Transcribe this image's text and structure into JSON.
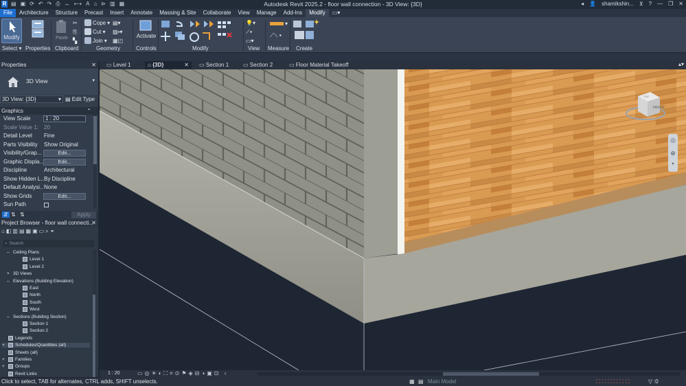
{
  "app": {
    "title": "Autodesk Revit 2025.2 - floor wall connection - 3D View: {3D}",
    "logo_letter": "R",
    "user": "shamikshin...",
    "help": "?"
  },
  "ribbon_tabs": [
    "File",
    "Architecture",
    "Structure",
    "Precast",
    "Insert",
    "Annotate",
    "Massing & Site",
    "Collaborate",
    "View",
    "Manage",
    "Add-Ins",
    "Modify"
  ],
  "ribbon": {
    "modify_label": "Modify",
    "select_label": "Select",
    "properties_label": "Properties",
    "clipboard_label": "Clipboard",
    "paste_label": "Paste",
    "cope_label": "Cope",
    "cut_label": "Cut",
    "join_label": "Join",
    "geometry_label": "Geometry",
    "activate_label": "Activate",
    "controls_label": "Controls",
    "modify_panel_label": "Modify",
    "view_label": "View",
    "measure_label": "Measure",
    "create_label": "Create"
  },
  "properties": {
    "title": "Properties",
    "type_name": "3D View",
    "selector": "3D View: {3D}",
    "edit_type": "Edit Type",
    "group": "Graphics",
    "rows": [
      {
        "k": "View Scale",
        "v": "1 : 20"
      },
      {
        "k": "Scale Value  1:",
        "v": "20"
      },
      {
        "k": "Detail Level",
        "v": "Fine"
      },
      {
        "k": "Parts Visibility",
        "v": "Show Original"
      },
      {
        "k": "Visibility/Grap...",
        "v": "Edit..."
      },
      {
        "k": "Graphic Displa...",
        "v": "Edit..."
      },
      {
        "k": "Discipline",
        "v": "Architectural"
      },
      {
        "k": "Show Hidden L...",
        "v": "By Discipline"
      },
      {
        "k": "Default Analysi...",
        "v": "None"
      },
      {
        "k": "Show Grids",
        "v": "Edit..."
      },
      {
        "k": "Sun Path",
        "v": ""
      }
    ],
    "apply": "Apply"
  },
  "browser": {
    "title": "Project Browser - floor wall connecti...",
    "search_placeholder": "Search",
    "items": [
      {
        "label": "Ceiling Plans",
        "indent": 1,
        "expander": "–"
      },
      {
        "label": "Level 1",
        "indent": 3,
        "expander": ""
      },
      {
        "label": "Level 2",
        "indent": 3,
        "expander": ""
      },
      {
        "label": "3D Views",
        "indent": 1,
        "expander": "+"
      },
      {
        "label": "Elevations (Building Elevation)",
        "indent": 1,
        "expander": "–"
      },
      {
        "label": "East",
        "indent": 3,
        "expander": ""
      },
      {
        "label": "North",
        "indent": 3,
        "expander": ""
      },
      {
        "label": "South",
        "indent": 3,
        "expander": ""
      },
      {
        "label": "West",
        "indent": 3,
        "expander": ""
      },
      {
        "label": "Sections (Building Section)",
        "indent": 1,
        "expander": "–"
      },
      {
        "label": "Section 1",
        "indent": 3,
        "expander": ""
      },
      {
        "label": "Section 2",
        "indent": 3,
        "expander": ""
      },
      {
        "label": "Legends",
        "indent": 0,
        "expander": ""
      },
      {
        "label": "Schedules/Quantities (all)",
        "indent": 0,
        "expander": "+"
      },
      {
        "label": "Sheets (all)",
        "indent": 0,
        "expander": ""
      },
      {
        "label": "Families",
        "indent": 0,
        "expander": "+"
      },
      {
        "label": "Groups",
        "indent": 0,
        "expander": "+"
      },
      {
        "label": "Revit Links",
        "indent": 0,
        "expander": ""
      }
    ]
  },
  "view_tabs": [
    {
      "label": "Level 1",
      "active": false
    },
    {
      "label": "{3D}",
      "active": true
    },
    {
      "label": "Section 1",
      "active": false
    },
    {
      "label": "Section 2",
      "active": false
    },
    {
      "label": "Floor Material Takeoff",
      "active": false
    }
  ],
  "viewcube": {
    "face_label": "FRONT",
    "top_label": "TOP"
  },
  "view_control": {
    "scale": "1 : 20"
  },
  "status": {
    "message": "Click to select, TAB for alternates, CTRL adds, SHIFT unselects.",
    "model": "Main Model",
    "filter_count": ":0"
  },
  "colors": {
    "accent": "#1f6fd1",
    "floor_wood": "#d99a52",
    "concrete": "#a8a89e",
    "block_wall": "#8b8d82",
    "background": "#1f2633"
  }
}
